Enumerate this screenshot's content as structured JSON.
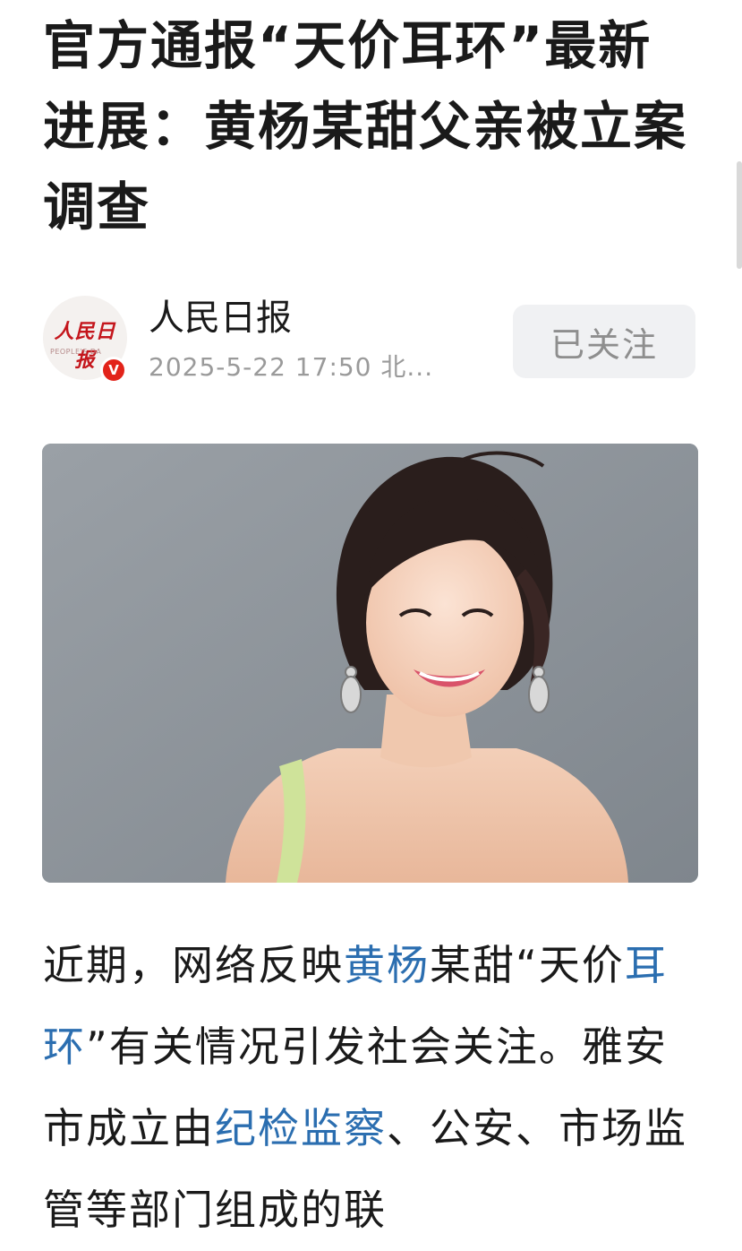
{
  "article": {
    "title": "官方通报“天价耳环”最新进展：黄杨某甜父亲被立案调查",
    "author": {
      "name": "人民日报",
      "avatar_logo": "人民日报",
      "avatar_sub": "PEOPLE'S DA",
      "verified_badge": "V",
      "meta": "2025-5-22  17:50  北..."
    },
    "follow_button_label": "已关注",
    "image_icon": "photo-of-woman-smiling-with-earrings",
    "body": [
      {
        "text": "近期，网络反映",
        "link": false
      },
      {
        "text": "黄杨",
        "link": true
      },
      {
        "text": "某甜“天价",
        "link": false
      },
      {
        "text": "耳环",
        "link": true
      },
      {
        "text": "”有关情况引发社会关注。雅安市成立由",
        "link": false
      },
      {
        "text": "纪检监察",
        "link": true
      },
      {
        "text": "、公安、市场监管等部门组成的联",
        "link": false
      }
    ]
  },
  "colors": {
    "link": "#2b6eb0",
    "verified": "#e2231a",
    "logo_red": "#c4161c",
    "follow_bg": "#f0f1f3"
  }
}
